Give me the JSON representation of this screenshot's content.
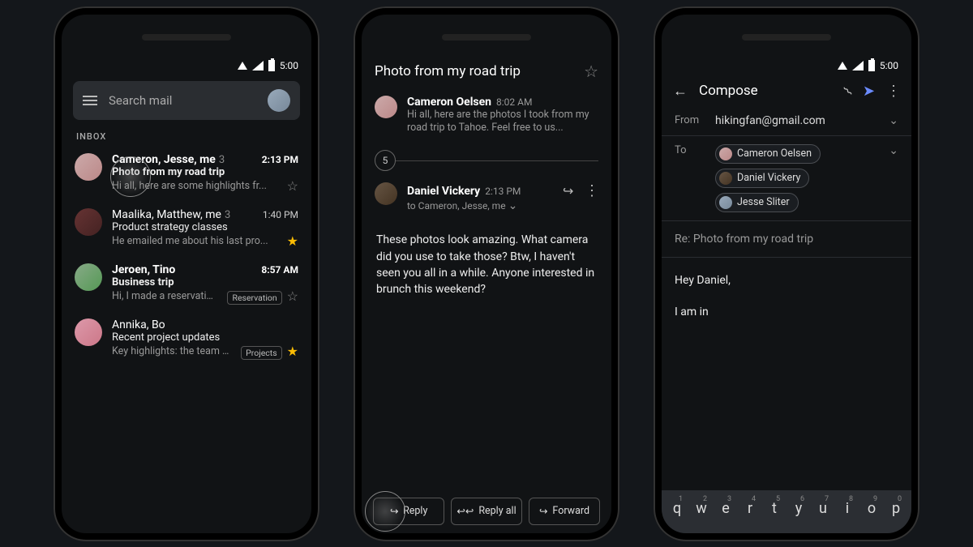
{
  "status": {
    "time": "5:00"
  },
  "inbox": {
    "search_placeholder": "Search mail",
    "section_label": "INBOX",
    "items": [
      {
        "senders": "Cameron, Jesse, me",
        "count": "3",
        "time": "2:13 PM",
        "subject": "Photo from my road trip",
        "snippet": "Hi all, here are some highlights fr...",
        "unread": true,
        "starred": false,
        "chips": []
      },
      {
        "senders": "Maalika, Matthew, me",
        "count": "3",
        "time": "1:40 PM",
        "subject": "Product strategy classes",
        "snippet": "He emailed me about his last pro...",
        "unread": false,
        "starred": true,
        "chips": []
      },
      {
        "senders": "Jeroen, Tino",
        "count": "",
        "time": "8:57 AM",
        "subject": "Business trip",
        "snippet": "Hi, I made a reservatio...",
        "unread": true,
        "starred": false,
        "chips": [
          "Reservation"
        ]
      },
      {
        "senders": "Annika, Bo",
        "count": "",
        "time": "",
        "subject": "Recent project updates",
        "snippet": "Key highlights: the team h...",
        "unread": false,
        "starred": true,
        "chips": [
          "Projects"
        ]
      }
    ]
  },
  "thread": {
    "title": "Photo from my road trip",
    "collapsed_count": "5",
    "messages": [
      {
        "sender": "Cameron Oelsen",
        "time": "8:02 AM",
        "snippet": "Hi all, here are the photos I took from my road trip to Tahoe. Feel free to us..."
      }
    ],
    "expanded": {
      "sender": "Daniel Vickery",
      "time": "2:13 PM",
      "recipients": "to Cameron, Jesse, me",
      "body": "These photos look amazing. What camera did you use to take those? Btw, I haven't seen you all in a while. Anyone interested in brunch this weekend?"
    },
    "actions": {
      "reply": "Reply",
      "reply_all": "Reply all",
      "forward": "Forward"
    }
  },
  "compose": {
    "title": "Compose",
    "from_label": "From",
    "from_value": "hikingfan@gmail.com",
    "to_label": "To",
    "recipients": [
      "Cameron Oelsen",
      "Daniel Vickery",
      "Jesse Sliter"
    ],
    "subject": "Re: Photo from my road trip",
    "body_greeting": "Hey Daniel,",
    "body_line": "I am in",
    "keys": [
      "q",
      "w",
      "e",
      "r",
      "t",
      "y",
      "u",
      "i",
      "o",
      "p"
    ],
    "nums": [
      "1",
      "2",
      "3",
      "4",
      "5",
      "6",
      "7",
      "8",
      "9",
      "0"
    ]
  }
}
